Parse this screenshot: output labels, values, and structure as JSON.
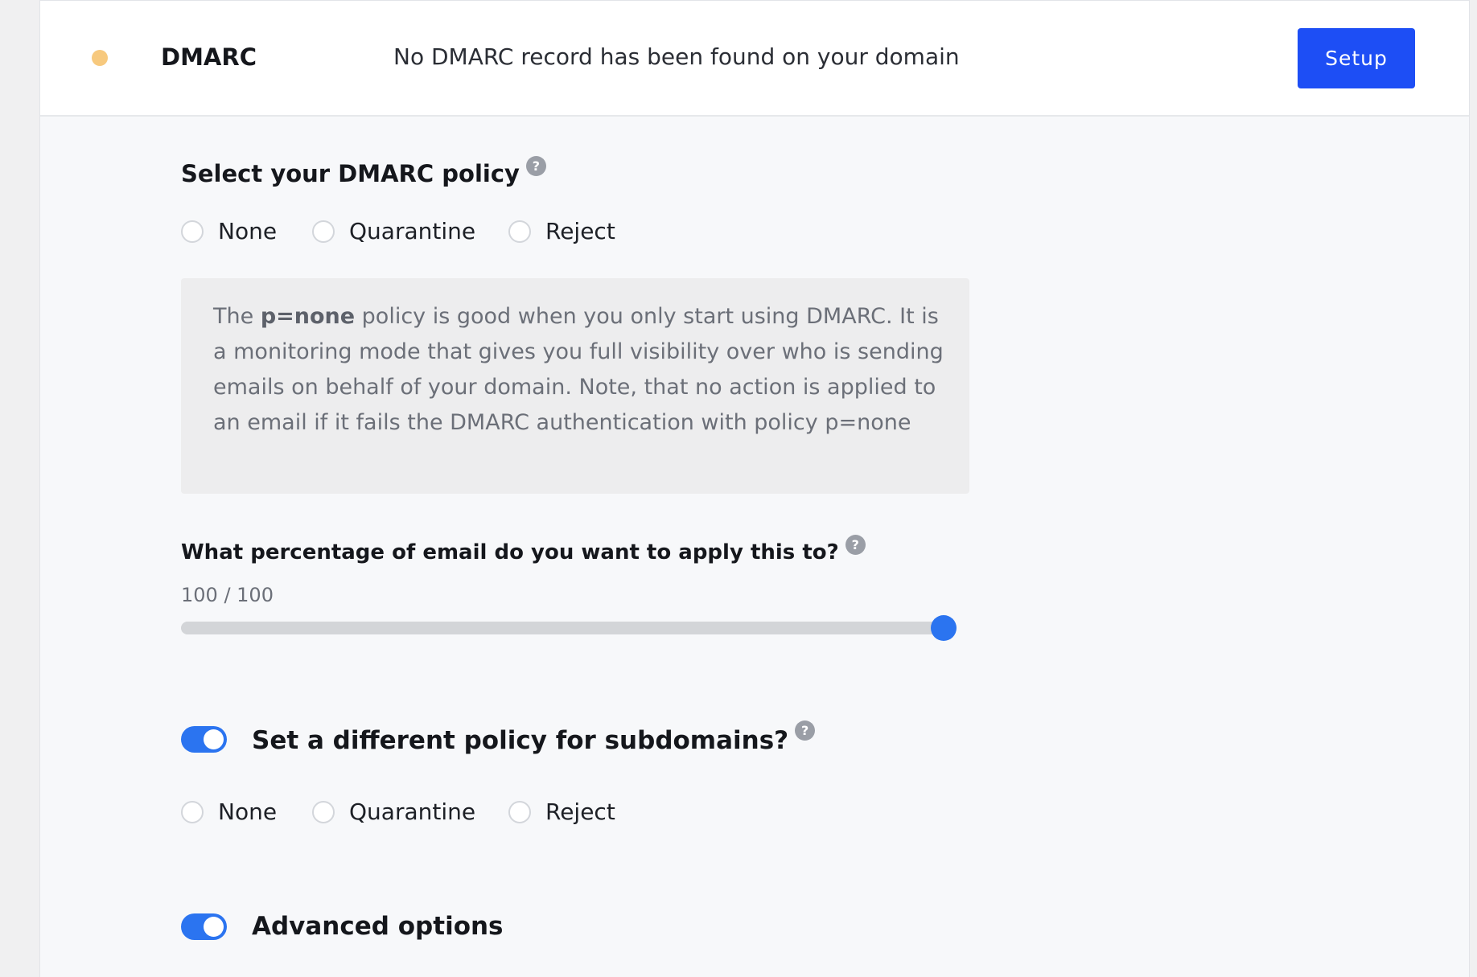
{
  "colors": {
    "status_dot": "#f7c97e",
    "primary_button": "#1d4ef5",
    "slider_thumb": "#2b74f0",
    "toggle_on": "#2b74f0"
  },
  "dmarc": {
    "title": "DMARC",
    "status": "warning",
    "message": "No DMARC record has been found on your domain",
    "setup_label": "Setup"
  },
  "policy": {
    "title": "Select your DMARC policy",
    "help_icon": "question-circle-icon",
    "options": [
      "None",
      "Quarantine",
      "Reject"
    ],
    "selected": null
  },
  "info_box": {
    "prefix": "The ",
    "highlight": "p=none",
    "rest": " policy is good when you only start using DMARC. It is a monitoring mode that gives you full visibility over who is sending emails on behalf of your domain. Note, that no action is applied to an email if it fails the DMARC authentication with policy p=none"
  },
  "percentage": {
    "title": "What percentage of email do you want to apply this to?",
    "value_text": "100 / 100",
    "value": 100,
    "max": 100
  },
  "subdomain": {
    "toggle_on": true,
    "label": "Set a different policy for subdomains?",
    "options": [
      "None",
      "Quarantine",
      "Reject"
    ],
    "selected": null
  },
  "advanced": {
    "toggle_on": true,
    "label": "Advanced options"
  }
}
